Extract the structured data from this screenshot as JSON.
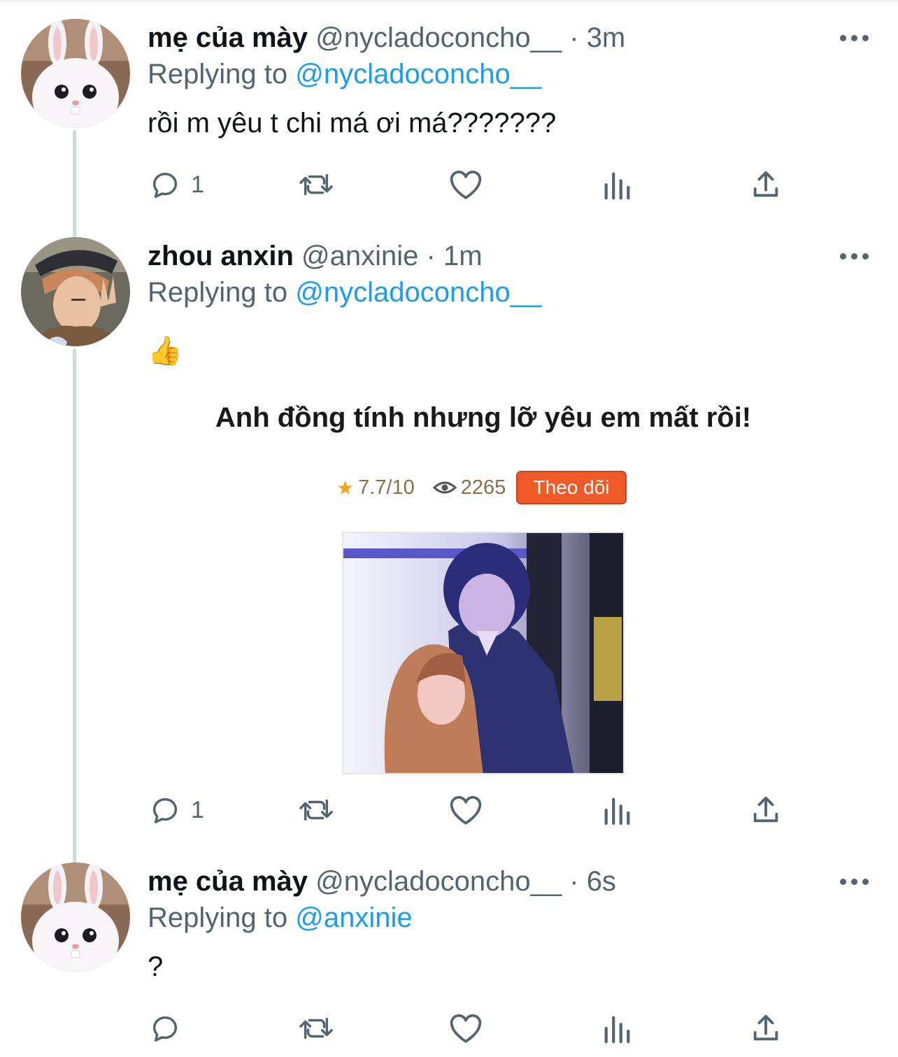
{
  "tweets": [
    {
      "name": "mẹ của mày",
      "handle": "@nycladoconcho__",
      "time": "3m",
      "replying_prefix": "Replying to",
      "replying_to": "@nycladoconcho__",
      "text": "rồi m yêu t chi má ơi má???????",
      "reply_count": "1",
      "avatar": "white-rabbit-avatar"
    },
    {
      "name": "zhou anxin",
      "handle": "@anxinie",
      "time": "1m",
      "replying_prefix": "Replying to",
      "replying_to": "@nycladoconcho__",
      "text": "👍",
      "reply_count": "1",
      "avatar": "person-peace-sign-avatar",
      "media": {
        "title": "Anh đồng tính nhưng lỡ yêu em mất rồi!",
        "rating": "7.7/10",
        "views": "2265",
        "follow_label": "Theo dõi"
      }
    },
    {
      "name": "mẹ của mày",
      "handle": "@nycladoconcho__",
      "time": "6s",
      "replying_prefix": "Replying to",
      "replying_to": "@anxinie",
      "text": "?",
      "reply_count": "",
      "avatar": "white-rabbit-avatar"
    }
  ],
  "separator": "·",
  "colors": {
    "primary_text": "#0f1419",
    "secondary_text": "#536471",
    "link": "#1d9bf0",
    "thread_line": "#cfd9de",
    "follow_button": "#f05a28"
  }
}
